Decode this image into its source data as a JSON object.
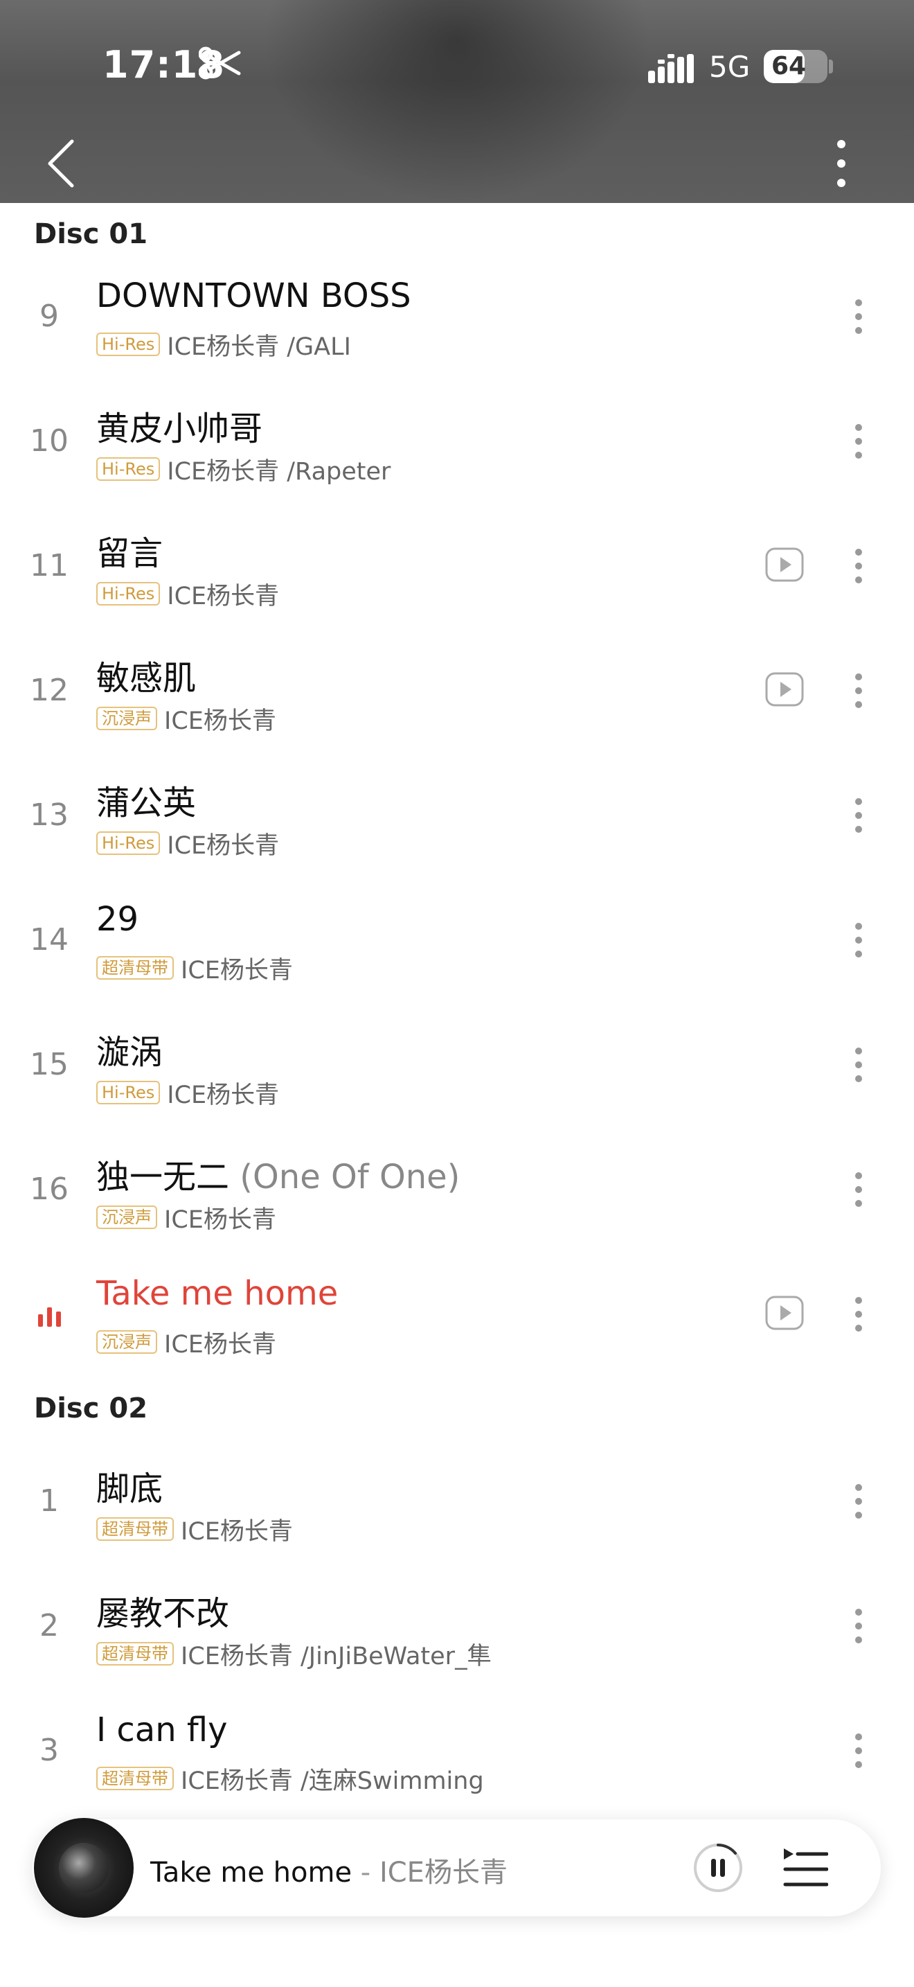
{
  "status_bar": {
    "time": "17:18",
    "network": "5G",
    "battery": "64",
    "battery_level": 0.64
  },
  "nav": {
    "back_icon": "chevron-left-icon",
    "more_icon": "more-vertical-icon"
  },
  "disc1": {
    "label": "Disc 01",
    "tracks": [
      {
        "index": "9",
        "title": "DOWNTOWN BOSS",
        "subtitle": "",
        "badge": "Hi-Res",
        "artists": "ICE杨长青 /GALI",
        "has_mv": false
      },
      {
        "index": "10",
        "title": "黄皮小帅哥",
        "subtitle": "",
        "badge": "Hi-Res",
        "artists": "ICE杨长青 /Rapeter",
        "has_mv": false
      },
      {
        "index": "11",
        "title": "留言",
        "subtitle": "",
        "badge": "Hi-Res",
        "artists": "ICE杨长青",
        "has_mv": true
      },
      {
        "index": "12",
        "title": "敏感肌",
        "subtitle": "",
        "badge": "沉浸声",
        "artists": "ICE杨长青",
        "has_mv": true
      },
      {
        "index": "13",
        "title": "蒲公英",
        "subtitle": "",
        "badge": "Hi-Res",
        "artists": "ICE杨长青",
        "has_mv": false
      },
      {
        "index": "14",
        "title": "29",
        "subtitle": "",
        "badge": "超清母带",
        "artists": "ICE杨长青",
        "has_mv": false
      },
      {
        "index": "15",
        "title": "漩涡",
        "subtitle": "",
        "badge": "Hi-Res",
        "artists": "ICE杨长青",
        "has_mv": false
      },
      {
        "index": "16",
        "title": "独一无二",
        "subtitle": "(One Of One)",
        "badge": "沉浸声",
        "artists": "ICE杨长青",
        "has_mv": false
      },
      {
        "index": "",
        "title": "Take me home",
        "subtitle": "",
        "badge": "沉浸声",
        "artists": "ICE杨长青",
        "has_mv": true,
        "playing": true
      }
    ]
  },
  "disc2": {
    "label": "Disc 02",
    "tracks": [
      {
        "index": "1",
        "title": "脚底",
        "subtitle": "",
        "badge": "超清母带",
        "artists": "ICE杨长青",
        "has_mv": false
      },
      {
        "index": "2",
        "title": "屡教不改",
        "subtitle": "",
        "badge": "超清母带",
        "artists": "ICE杨长青 /JinJiBeWater_隼",
        "has_mv": false
      },
      {
        "index": "3",
        "title": "I can fly",
        "subtitle": "",
        "badge": "超清母带",
        "artists": "ICE杨长青 /连麻Swimming",
        "has_mv": false
      }
    ]
  },
  "mini_player": {
    "title": "Take me home",
    "separator": "-",
    "artist": "ICE杨长青",
    "pause_icon": "pause-icon",
    "queue_icon": "playlist-icon"
  },
  "colors": {
    "accent": "#e0443a",
    "badge_border": "#e6c27c",
    "badge_text": "#cf9b3c"
  }
}
